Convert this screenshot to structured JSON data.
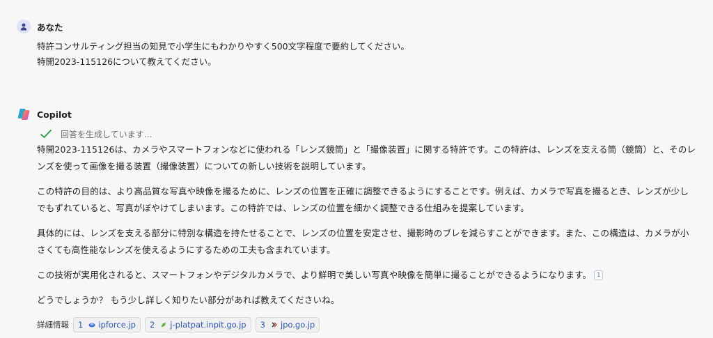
{
  "user": {
    "name": "あなた",
    "lines": [
      "特許コンサルティング担当の知見で小学生にもわかりやすく500文字程度で要約してください。",
      "特開2023-115126について教えてください。"
    ]
  },
  "bot": {
    "name": "Copilot",
    "status": "回答を生成しています…",
    "paragraphs": [
      "特開2023-115126は、カメラやスマートフォンなどに使われる「レンズ鏡筒」と「撮像装置」に関する特許です。この特許は、レンズを支える筒（鏡筒）と、そのレンズを使って画像を撮る装置（撮像装置）についての新しい技術を説明しています。",
      "この特許の目的は、より高品質な写真や映像を撮るために、レンズの位置を正確に調整できるようにすることです。例えば、カメラで写真を撮るとき、レンズが少しでもずれていると、写真がぼやけてしまいます。この特許では、レンズの位置を細かく調整できる仕組みを提案しています。",
      "具体的には、レンズを支える部分に特別な構造を持たせることで、レンズの位置を安定させ、撮影時のブレを減らすことができます。また、この構造は、カメラが小さくても高性能なレンズを使えるようにするための工夫も含まれています。",
      "この技術が実用化されると、スマートフォンやデジタルカメラで、より鮮明で美しい写真や映像を簡単に撮ることができるようになります。",
      "どうでしょうか？ もう少し詳しく知りたい部分があれば教えてくださいね。"
    ],
    "citation": "1",
    "details_label": "詳細情報",
    "sources": [
      {
        "num": "1",
        "label": "ipforce.jp",
        "color": "#3a6fd8"
      },
      {
        "num": "2",
        "label": "j-platpat.inpit.go.jp",
        "color": "#6cbf4a"
      },
      {
        "num": "3",
        "label": "jpo.go.jp",
        "color": "#c0392b"
      }
    ]
  }
}
